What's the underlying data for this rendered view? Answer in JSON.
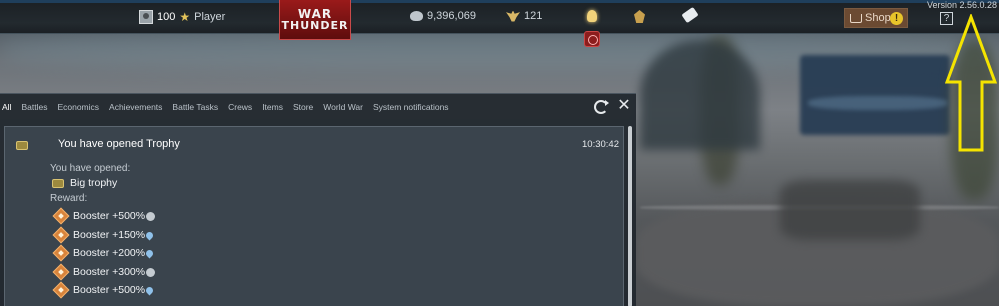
{
  "topbar": {
    "level": "100",
    "player_name": "Player",
    "logo_line1": "WAR",
    "logo_line2": "THUNDER",
    "silver_lions": "9,396,069",
    "golden_eagles": "121",
    "shop_label": "Shop",
    "shop_alert": "!",
    "help_label": "?",
    "version": "Version 2.56.0.28"
  },
  "notifications": {
    "tabs": [
      "All",
      "Battles",
      "Economics",
      "Achievements",
      "Battle Tasks",
      "Crews",
      "Items",
      "Store",
      "World War",
      "System notifications"
    ],
    "active_tab": "All",
    "close_label": "✕",
    "entry": {
      "title": "You have opened Trophy",
      "time": "10:30:42",
      "opened_label": "You have opened:",
      "item_name": "Big trophy",
      "reward_label": "Reward:",
      "rewards": [
        {
          "label": "Booster +500%",
          "kind": "silver-lions-icon"
        },
        {
          "label": "Booster +150%",
          "kind": "research-points-icon"
        },
        {
          "label": "Booster +200%",
          "kind": "research-points-icon"
        },
        {
          "label": "Booster +300%",
          "kind": "silver-lions-icon"
        },
        {
          "label": "Booster +500%",
          "kind": "research-points-icon"
        }
      ]
    }
  },
  "colors": {
    "annotation_arrow": "#f5e400",
    "logo_red": "#9a1a1a",
    "shop_brown": "#6b4a32"
  }
}
